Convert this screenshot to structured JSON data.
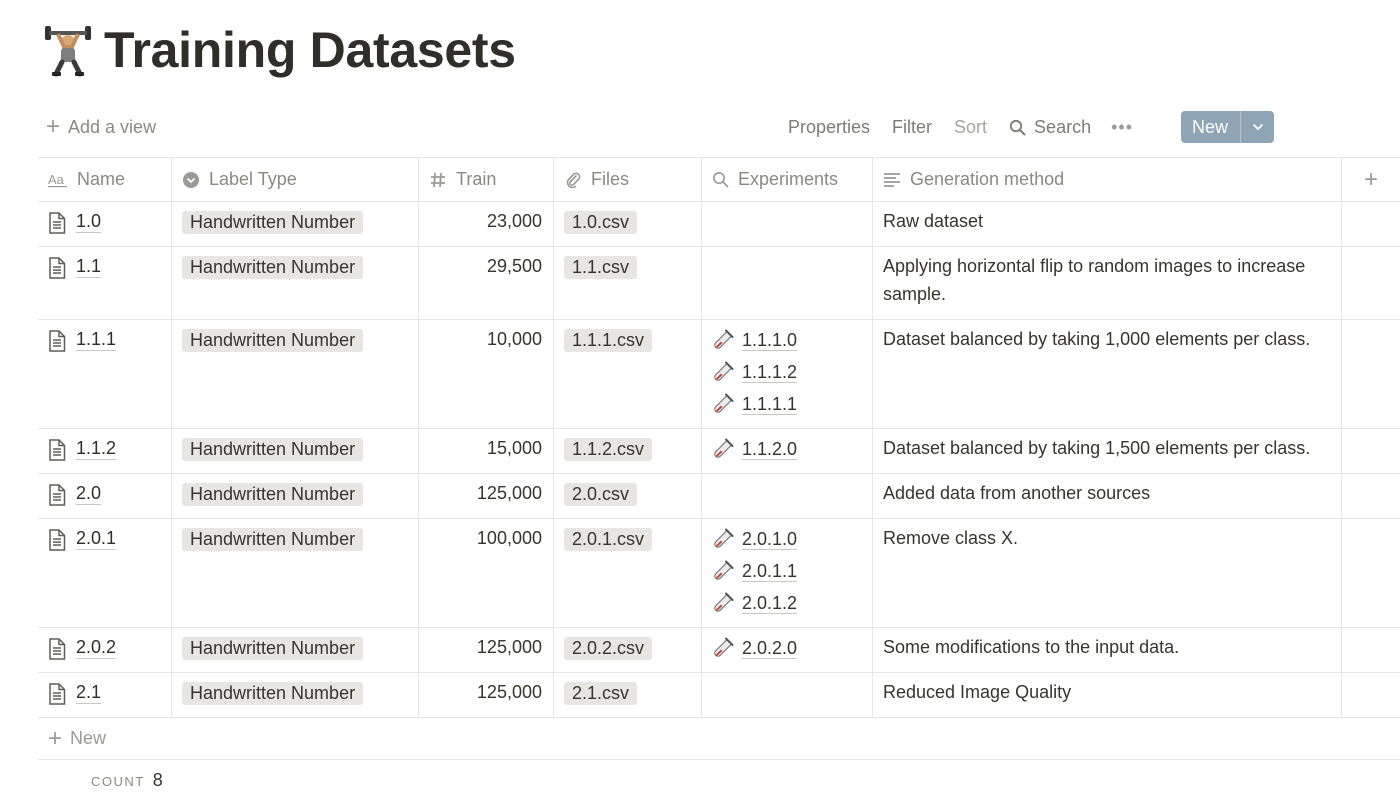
{
  "page": {
    "icon": "weightlifter-emoji-icon",
    "title": "Training Datasets"
  },
  "toolbar": {
    "add_view_label": "Add a view",
    "properties_label": "Properties",
    "filter_label": "Filter",
    "sort_label": "Sort",
    "search_label": "Search",
    "more_label": "•••",
    "new_label": "New"
  },
  "columns": [
    {
      "label": "Name",
      "icon": "text-aa-icon"
    },
    {
      "label": "Label Type",
      "icon": "select-icon"
    },
    {
      "label": "Train",
      "icon": "number-hash-icon"
    },
    {
      "label": "Files",
      "icon": "paperclip-icon"
    },
    {
      "label": "Experiments",
      "icon": "search-relation-icon"
    },
    {
      "label": "Generation method",
      "icon": "text-lines-icon"
    }
  ],
  "rows": [
    {
      "name": "1.0",
      "label_type": "Handwritten Number",
      "train": "23,000",
      "file": "1.0.csv",
      "experiments": [],
      "generation": "Raw dataset"
    },
    {
      "name": "1.1",
      "label_type": "Handwritten Number",
      "train": "29,500",
      "file": "1.1.csv",
      "experiments": [],
      "generation": "Applying horizontal flip to random images to increase sample."
    },
    {
      "name": "1.1.1",
      "label_type": "Handwritten Number",
      "train": "10,000",
      "file": "1.1.1.csv",
      "experiments": [
        "1.1.1.0",
        "1.1.1.2",
        "1.1.1.1"
      ],
      "generation": "Dataset balanced by taking 1,000 elements per class."
    },
    {
      "name": "1.1.2",
      "label_type": "Handwritten Number",
      "train": "15,000",
      "file": "1.1.2.csv",
      "experiments": [
        "1.1.2.0"
      ],
      "generation": "Dataset balanced by taking 1,500 elements per class."
    },
    {
      "name": "2.0",
      "label_type": "Handwritten Number",
      "train": "125,000",
      "file": "2.0.csv",
      "experiments": [],
      "generation": "Added data from another sources"
    },
    {
      "name": "2.0.1",
      "label_type": "Handwritten Number",
      "train": "100,000",
      "file": "2.0.1.csv",
      "experiments": [
        "2.0.1.0",
        "2.0.1.1",
        "2.0.1.2"
      ],
      "generation": "Remove class X."
    },
    {
      "name": "2.0.2",
      "label_type": "Handwritten Number",
      "train": "125,000",
      "file": "2.0.2.csv",
      "experiments": [
        "2.0.2.0"
      ],
      "generation": "Some modifications to the input data."
    },
    {
      "name": "2.1",
      "label_type": "Handwritten Number",
      "train": "125,000",
      "file": "2.1.csv",
      "experiments": [],
      "generation": "Reduced Image Quality"
    }
  ],
  "footer": {
    "add_row_label": "New",
    "count_label": "COUNT",
    "count_value": "8"
  }
}
